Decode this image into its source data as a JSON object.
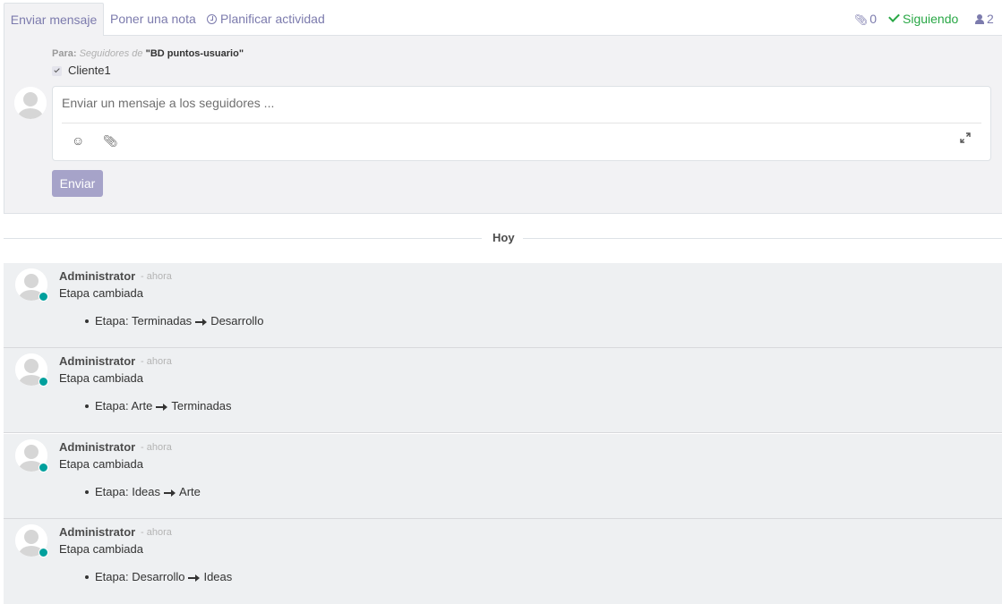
{
  "tabs": {
    "send_message": "Enviar mensaje",
    "log_note": "Poner una nota",
    "schedule_activity": "Planificar actividad"
  },
  "header_controls": {
    "attachments_count": "0",
    "following_label": "Siguiendo",
    "followers_count": "2"
  },
  "composer": {
    "to_label": "Para:",
    "followers_of": "Seguidores de",
    "record_name": "\"BD puntos-usuario\"",
    "recipient": "Cliente1",
    "placeholder": "Enviar un mensaje a los seguidores ...",
    "send_label": "Enviar"
  },
  "date_separator": "Hoy",
  "colors": {
    "accent": "#7c7bad",
    "following": "#28a745",
    "presence": "#00a09d",
    "send_button": "#a6a3c9"
  },
  "messages": [
    {
      "author": "Administrator",
      "date": "- ahora",
      "subject": "Etapa cambiada",
      "field": "Etapa:",
      "old_value": "Terminadas",
      "new_value": "Desarrollo"
    },
    {
      "author": "Administrator",
      "date": "- ahora",
      "subject": "Etapa cambiada",
      "field": "Etapa:",
      "old_value": "Arte",
      "new_value": "Terminadas"
    },
    {
      "author": "Administrator",
      "date": "- ahora",
      "subject": "Etapa cambiada",
      "field": "Etapa:",
      "old_value": "Ideas",
      "new_value": "Arte"
    },
    {
      "author": "Administrator",
      "date": "- ahora",
      "subject": "Etapa cambiada",
      "field": "Etapa:",
      "old_value": "Desarrollo",
      "new_value": "Ideas"
    }
  ]
}
